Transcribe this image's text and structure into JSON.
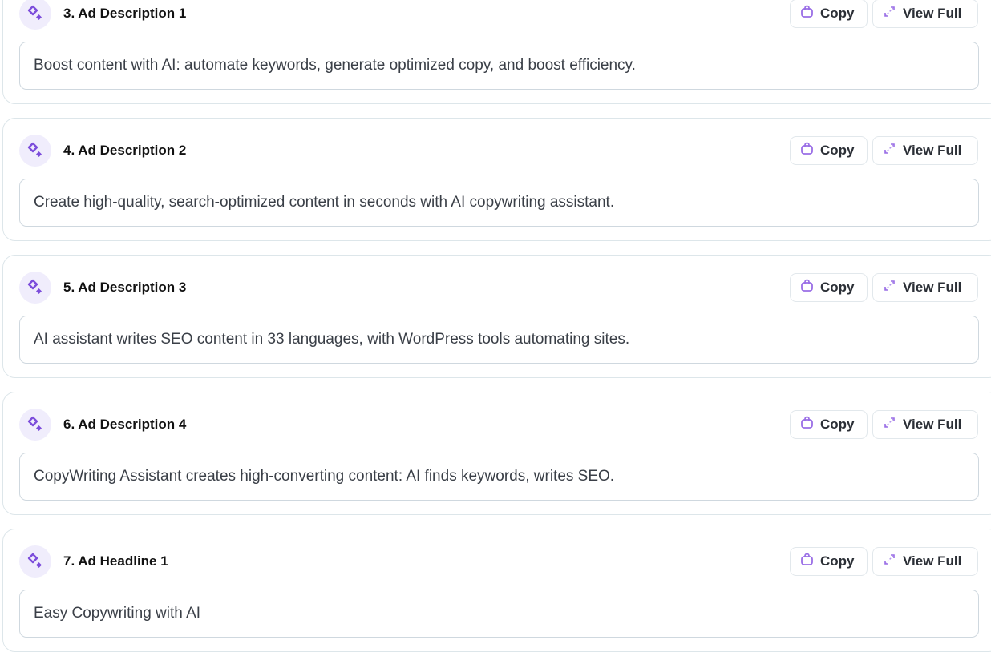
{
  "colors": {
    "accent": "#7c4ddb",
    "icon_bg": "#f0edfc"
  },
  "icons": {
    "item": "sparkle-diamond-icon",
    "copy": "clipboard-icon",
    "view_full": "expand-icon"
  },
  "buttons": {
    "copy": "Copy",
    "view_full": "View Full"
  },
  "items": [
    {
      "title": "3. Ad Description 1",
      "text": "Boost content with AI: automate keywords, generate optimized copy, and boost efficiency."
    },
    {
      "title": "4. Ad Description 2",
      "text": "Create high-quality, search-optimized content in seconds with AI copywriting assistant."
    },
    {
      "title": "5. Ad Description 3",
      "text": "AI assistant writes SEO content in 33 languages, with WordPress tools automating sites."
    },
    {
      "title": "6. Ad Description 4",
      "text": "CopyWriting Assistant creates high-converting content: AI finds keywords, writes SEO."
    },
    {
      "title": "7. Ad Headline 1",
      "text": "Easy Copywriting with AI"
    }
  ]
}
